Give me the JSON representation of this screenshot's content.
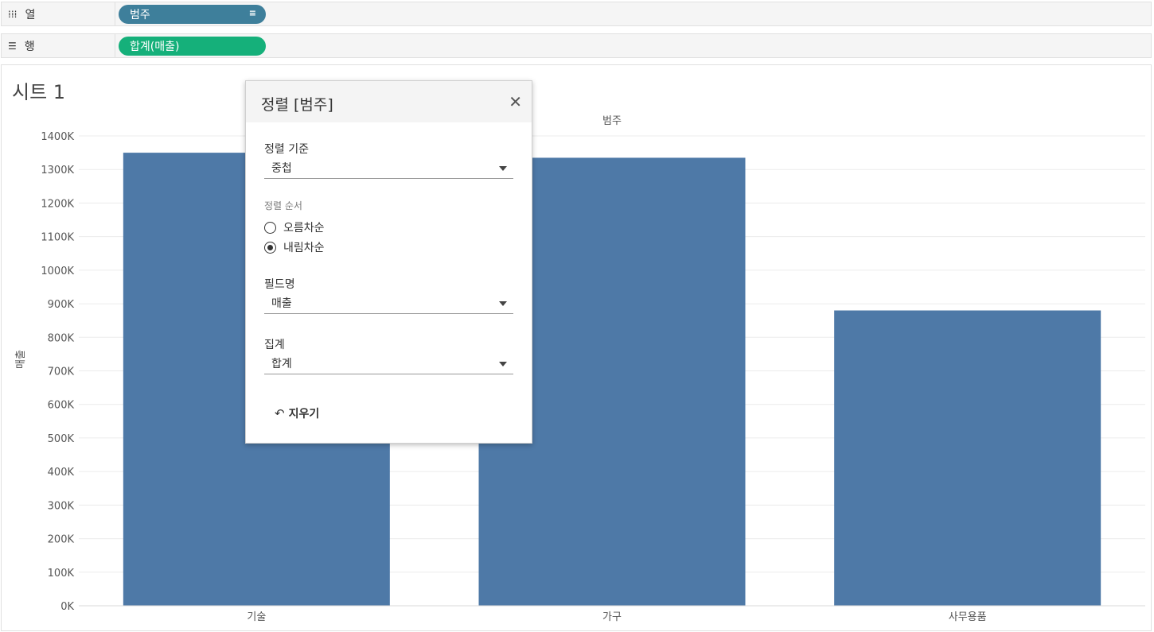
{
  "shelves": {
    "columns": {
      "icon": "columns-shelf-icon",
      "label": "열",
      "pill": "범주",
      "pill_color": "#3e7f9b",
      "sort_icon": "sort-descending-icon"
    },
    "rows": {
      "icon": "rows-shelf-icon",
      "label": "행",
      "pill": "합계(매출)",
      "pill_color": "#15b07a"
    }
  },
  "sheet": {
    "title": "시트 1"
  },
  "chart_data": {
    "type": "bar",
    "header": "범주",
    "categories": [
      "기술",
      "가구",
      "사무용품"
    ],
    "values": [
      1350000,
      1335000,
      880000
    ],
    "ylabel": "매출",
    "ylim": [
      0,
      1400000
    ],
    "yticks": [
      "0K",
      "100K",
      "200K",
      "300K",
      "400K",
      "500K",
      "600K",
      "700K",
      "800K",
      "900K",
      "1000K",
      "1100K",
      "1200K",
      "1300K",
      "1400K"
    ],
    "bar_color": "#4e79a7",
    "grid": true
  },
  "sort_dialog": {
    "title": "정렬 [범주]",
    "sort_by_label": "정렬 기준",
    "sort_by_value": "중첩",
    "order_label": "정렬 순서",
    "ascending": "오름차순",
    "descending": "내림차순",
    "selected_order": "descending",
    "field_label": "필드명",
    "field_value": "매출",
    "agg_label": "집계",
    "agg_value": "합계",
    "clear_label": "지우기"
  }
}
